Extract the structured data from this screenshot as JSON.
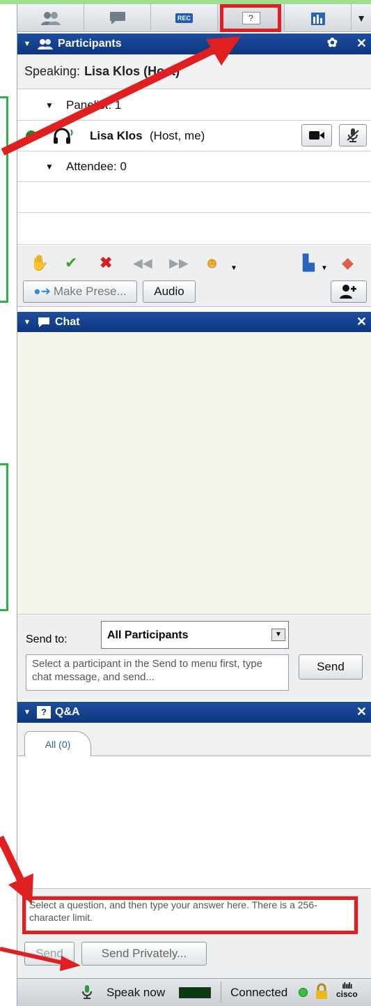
{
  "tabs": [
    {
      "icon": "participants-icon"
    },
    {
      "icon": "chat-icon"
    },
    {
      "icon": "record-icon",
      "label": "REC"
    },
    {
      "icon": "question-icon",
      "label": "?"
    },
    {
      "icon": "poll-icon"
    }
  ],
  "participants_panel": {
    "title": "Participants",
    "speaking_label": "Speaking:",
    "speaking_name": "Lisa Klos (Host)",
    "panelist_group": "Panelist: 1",
    "member_name": "Lisa Klos",
    "member_role": "(Host, me)",
    "attendee_group": "Attendee: 0",
    "make_presenter": "Make Prese...",
    "audio": "Audio"
  },
  "chat_panel": {
    "title": "Chat",
    "send_to_label": "Send to:",
    "send_to_value": "All Participants",
    "message_placeholder": "Select a participant in the Send to menu first, type chat message, and send...",
    "send": "Send"
  },
  "qa_panel": {
    "title": "Q&A",
    "tab_all": "All (0)",
    "answer_placeholder": "Select a question, and then type your answer here. There is a 256-character limit.",
    "send": "Send",
    "send_privately": "Send Privately..."
  },
  "status_bar": {
    "speak_now": "Speak now",
    "connected": "Connected",
    "brand": "cisco"
  },
  "colors": {
    "header_blue": "#0d3580",
    "annotation_red": "#e02020",
    "annotation_green": "#2bb34a"
  }
}
